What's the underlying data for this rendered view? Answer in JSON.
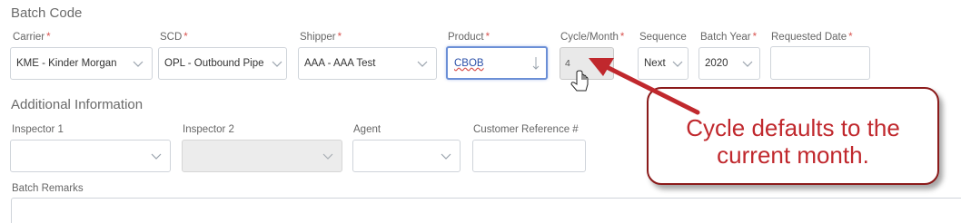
{
  "batch_code": {
    "title": "Batch Code",
    "carrier": {
      "label": "Carrier",
      "required": "*",
      "value": "KME - Kinder Morgan"
    },
    "scd": {
      "label": "SCD",
      "required": "*",
      "value": "OPL - Outbound Pipe"
    },
    "shipper": {
      "label": "Shipper",
      "required": "*",
      "value": "AAA - AAA Test"
    },
    "product": {
      "label": "Product",
      "required": "*",
      "value": "CBOB"
    },
    "cycle": {
      "label": "Cycle/Month",
      "required": "*",
      "value": "4"
    },
    "sequence": {
      "label": "Sequence",
      "value": "Next"
    },
    "batch_year": {
      "label": "Batch Year",
      "required": "*",
      "value": "2020"
    },
    "requested_date": {
      "label": "Requested Date",
      "required": "*",
      "value": ""
    }
  },
  "additional_info": {
    "title": "Additional Information",
    "inspector1": {
      "label": "Inspector 1",
      "value": ""
    },
    "inspector2": {
      "label": "Inspector 2",
      "value": ""
    },
    "agent": {
      "label": "Agent",
      "value": ""
    },
    "customer_ref": {
      "label": "Customer Reference #",
      "value": ""
    }
  },
  "remarks": {
    "label": "Batch Remarks",
    "value": ""
  },
  "callout": {
    "line1": "Cycle defaults to the",
    "line2": "current month."
  },
  "colors": {
    "callout_text": "#c0282d",
    "callout_border": "#8b1a1a",
    "arrow": "#c0282d",
    "required": "#d9534f"
  }
}
